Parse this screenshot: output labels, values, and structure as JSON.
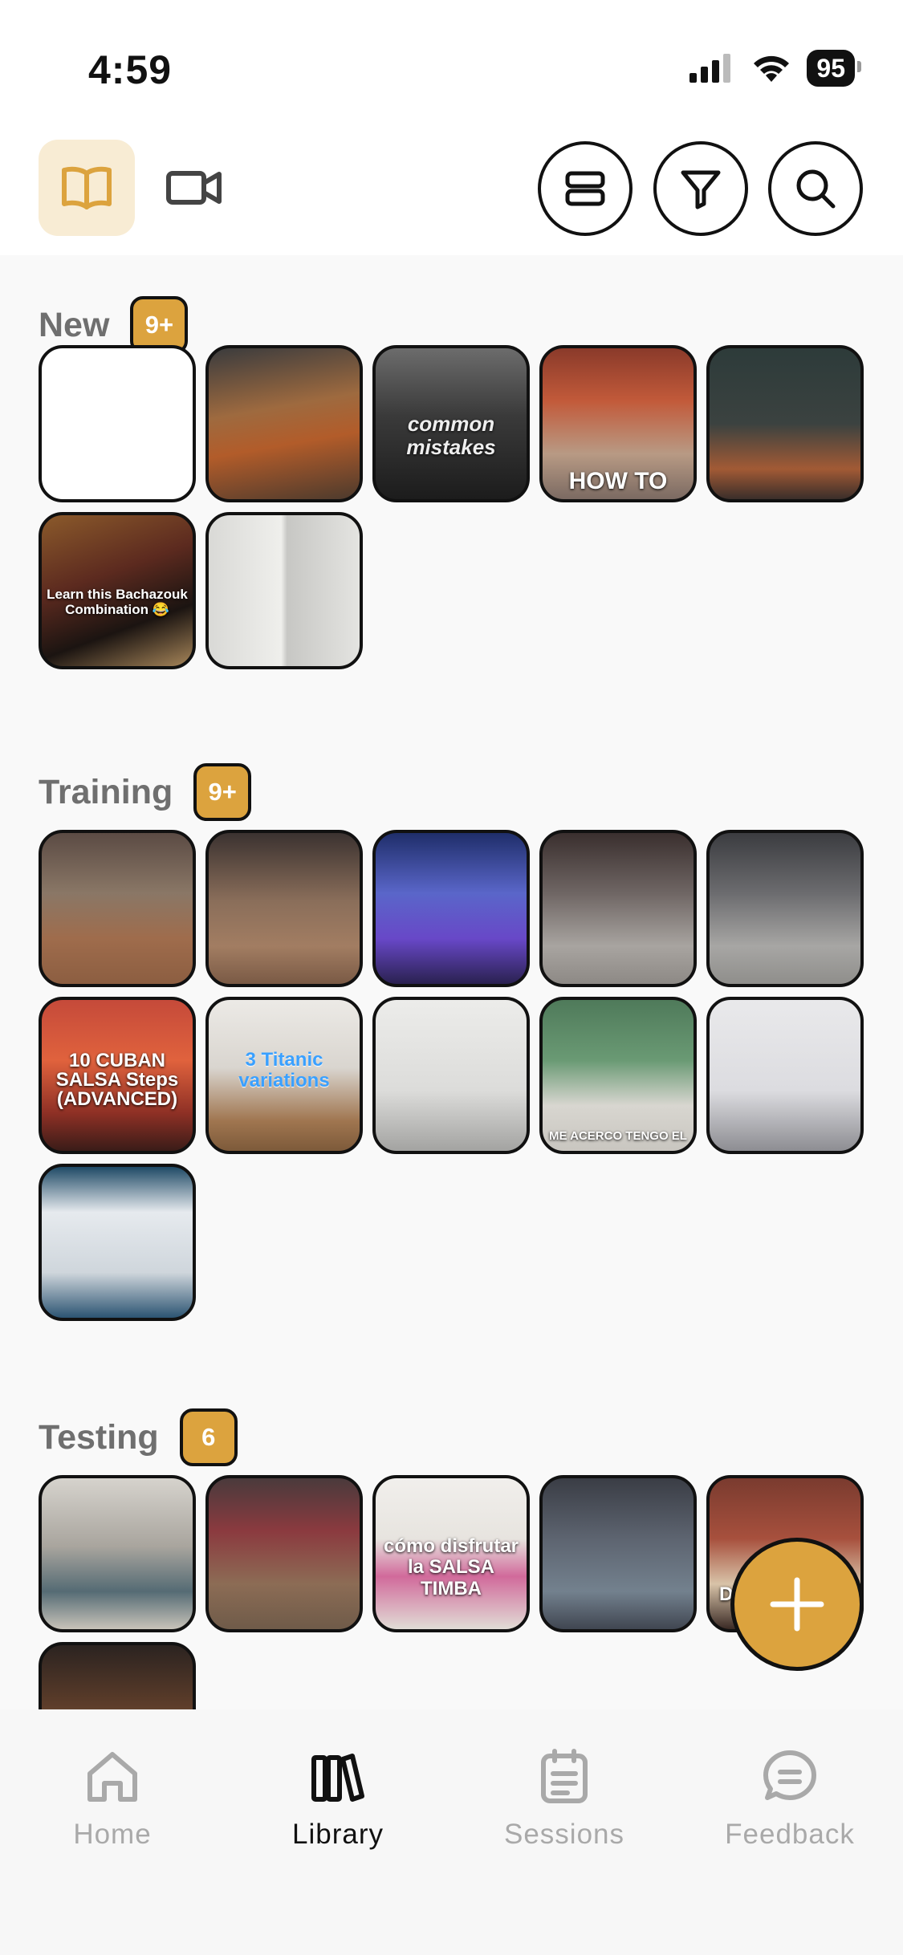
{
  "status_bar": {
    "time": "4:59",
    "battery": "95"
  },
  "header": {
    "modes": [
      {
        "name": "library-book",
        "active": true
      },
      {
        "name": "video-camera",
        "active": false
      }
    ],
    "actions": [
      "layout-list",
      "filter",
      "search"
    ]
  },
  "sections": [
    {
      "title": "New",
      "badge": "9+",
      "captions": [
        "",
        "",
        "common mistakes",
        "HOW TO",
        "",
        "Learn this Bachazouk Combination 😂",
        ""
      ]
    },
    {
      "title": "Training",
      "badge": "9+",
      "captions": [
        "",
        "",
        "",
        "",
        "",
        "10 CUBAN SALSA Steps (ADVANCED)",
        "3 Titanic variations",
        "",
        "ME ACERCO TENGO EL",
        "",
        ""
      ]
    },
    {
      "title": "Testing",
      "badge": "6",
      "captions": [
        "",
        "",
        "cómo disfrutar la SALSA TIMBA",
        "",
        "D",
        ""
      ]
    }
  ],
  "tabbar": {
    "items": [
      {
        "label": "Home",
        "icon": "home-icon",
        "active": false
      },
      {
        "label": "Library",
        "icon": "library-icon",
        "active": true
      },
      {
        "label": "Sessions",
        "icon": "clipboard-icon",
        "active": false
      },
      {
        "label": "Feedback",
        "icon": "chat-icon",
        "active": false
      }
    ]
  },
  "colors": {
    "accent": "#dca33e",
    "accent_bg": "#f8ecd4",
    "inactive": "#a9a9a9"
  }
}
